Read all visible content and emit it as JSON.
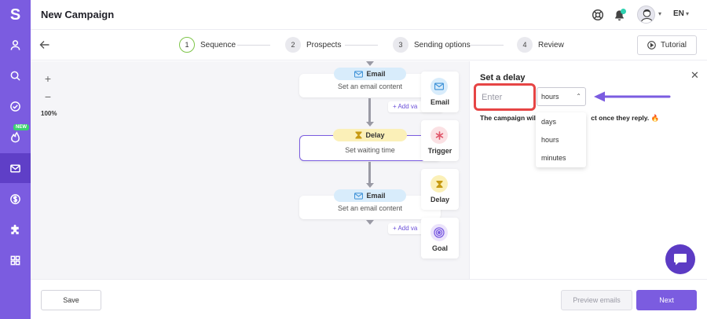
{
  "app": {
    "logo": "S",
    "title": "New Campaign"
  },
  "sidebar": {
    "items": [
      {
        "icon": "user-icon"
      },
      {
        "icon": "search-icon"
      },
      {
        "icon": "check-circle-icon"
      },
      {
        "icon": "fire-icon",
        "badge": "NEW"
      },
      {
        "icon": "mail-icon",
        "active": true
      },
      {
        "icon": "dollar-icon"
      },
      {
        "icon": "puzzle-icon"
      },
      {
        "icon": "apps-grid-icon"
      }
    ]
  },
  "header": {
    "language": "EN"
  },
  "steps": [
    {
      "number": "1",
      "label": "Sequence",
      "active": true
    },
    {
      "number": "2",
      "label": "Prospects"
    },
    {
      "number": "3",
      "label": "Sending options"
    },
    {
      "number": "4",
      "label": "Review"
    }
  ],
  "tutorial_label": "Tutorial",
  "canvas": {
    "zoom_in": "+",
    "zoom_out": "−",
    "zoom_level": "100%",
    "nodes": [
      {
        "type": "Email",
        "content": "Set an email content"
      },
      {
        "type": "Delay",
        "content": "Set waiting time"
      },
      {
        "type": "Email",
        "content": "Set an email content"
      }
    ],
    "add_variant": "+ Add va",
    "palette": [
      "Email",
      "Trigger",
      "Delay",
      "Goal"
    ]
  },
  "panel": {
    "title": "Set a delay",
    "input_placeholder": "Enter",
    "selected_unit": "hours",
    "options": [
      "days",
      "hours",
      "minutes"
    ],
    "note_start": "The campaign will",
    "note_end": "ct once they reply.",
    "emoji": "🔥"
  },
  "footer": {
    "save": "Save",
    "preview": "Preview emails",
    "next": "Next"
  },
  "colors": {
    "brand": "#7b5ce0",
    "highlight": "#e64545",
    "step_active": "#7fc54a"
  }
}
